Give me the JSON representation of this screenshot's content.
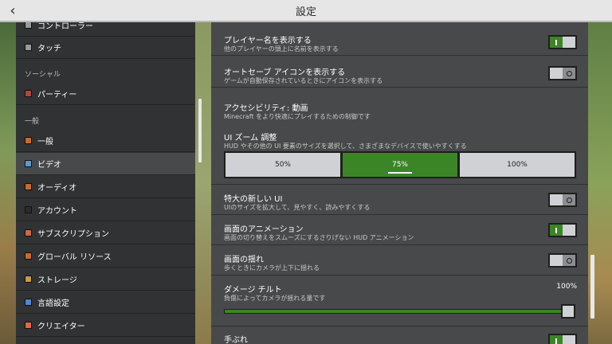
{
  "title": "設定",
  "sidebar": {
    "items": [
      {
        "label": "コントローラー",
        "icon": "controller-icon",
        "color": "#9a9a9a"
      },
      {
        "label": "タッチ",
        "icon": "touch-icon",
        "color": "#9a9a9a"
      },
      {
        "label": "パーティー",
        "icon": "party-icon",
        "color": "#b0463a"
      },
      {
        "label": "一般",
        "icon": "general-icon",
        "color": "#c86a2a"
      },
      {
        "label": "ビデオ",
        "icon": "video-icon",
        "color": "#5a9ad0"
      },
      {
        "label": "オーディオ",
        "icon": "audio-icon",
        "color": "#c86a2a"
      },
      {
        "label": "アカウント",
        "icon": "account-icon",
        "color": "#2a2a2a"
      },
      {
        "label": "サブスクリプション",
        "icon": "subscription-icon",
        "color": "#d0683a"
      },
      {
        "label": "グローバル リソース",
        "icon": "global-resources-icon",
        "color": "#c86a2a"
      },
      {
        "label": "ストレージ",
        "icon": "storage-icon",
        "color": "#c89a4a"
      },
      {
        "label": "言語設定",
        "icon": "language-icon",
        "color": "#4a8ad0"
      },
      {
        "label": "クリエイター",
        "icon": "creator-icon",
        "color": "#e06a3a"
      }
    ],
    "headers": {
      "social": "ソーシャル",
      "general": "一般"
    }
  },
  "settings": {
    "show_player_name": {
      "title": "プレイヤー名を表示する",
      "desc": "他のプレイヤーの頭上に名前を表示する",
      "enabled": true
    },
    "autosave_icon": {
      "title": "オートセーブ アイコンを表示する",
      "desc": "ゲームが自動保存されているときにアイコンを表示する",
      "enabled": false
    },
    "accessibility_header": {
      "title": "アクセシビリティ: 動画",
      "desc": "Minecraft をより快適にプレイするための制御です"
    },
    "ui_zoom": {
      "title": "UI ズーム 調整",
      "desc": "HUD やその他の UI 要素のサイズを選択して、さまざまなデバイスで使いやすくする",
      "options": [
        "50%",
        "75%",
        "100%"
      ],
      "selected": "75%"
    },
    "large_ui": {
      "title": "特大の新しい UI",
      "desc": "UIのサイズを拡大して、見やすく、読みやすくする",
      "enabled": false
    },
    "screen_animations": {
      "title": "画面のアニメーション",
      "desc": "画面の切り替えをスムーズにするさりげない HUD アニメーション",
      "enabled": true
    },
    "view_bobbing": {
      "title": "画面の揺れ",
      "desc": "歩くときにカメラが上下に揺れる",
      "enabled": false
    },
    "damage_tilt": {
      "title": "ダメージ チルト",
      "desc": "負傷によってカメラが揺れる量です",
      "value": "100%",
      "level": 1.0
    },
    "camera_shake": {
      "title": "手ぶれ",
      "enabled": true
    }
  },
  "colors": {
    "accent_green": "#3c8527",
    "panel": "#48494a",
    "sidebar": "#313233"
  }
}
